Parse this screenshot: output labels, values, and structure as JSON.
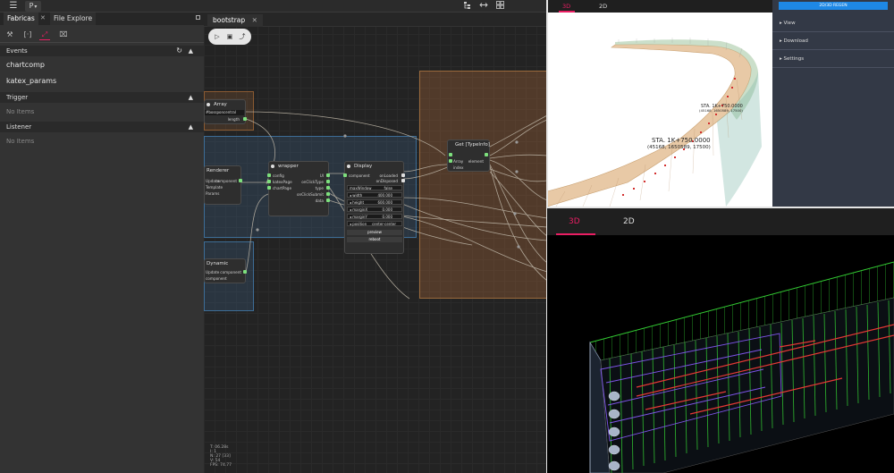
{
  "topbar": {
    "menu_icon": "menu-icon",
    "project_label": "P",
    "caret": "▾",
    "layout_icons": [
      "hierarchy-icon",
      "split-icon",
      "grid-icon"
    ]
  },
  "left_panel": {
    "tabs": [
      {
        "label": "Fabricas"
      },
      {
        "label": "File Explore"
      }
    ],
    "close_glyph": "✕",
    "tools": [
      "tools-icon",
      "braces-icon",
      "connect-icon",
      "screenshot-icon"
    ],
    "sections": {
      "events": {
        "label": "Events",
        "items": [
          "chartcomp",
          "katex_params"
        ]
      },
      "trigger": {
        "label": "Trigger",
        "empty": "No Items"
      },
      "listener": {
        "label": "Listener",
        "empty": "No Items"
      }
    }
  },
  "editor": {
    "tab_label": "bootstrap",
    "nodes": {
      "array": {
        "title": "Array",
        "field": "#bossponcentral",
        "out": "length"
      },
      "renderer": {
        "title": "Renderer",
        "inputs": [
          "Update",
          "Template",
          "Params"
        ],
        "out": "component"
      },
      "dynamic": {
        "title": "Dynamic",
        "inputs": [
          "Update",
          "component"
        ],
        "out": "component"
      },
      "wrapper": {
        "title": "wrapper",
        "inputs": [
          "config",
          "katexPage",
          "chartPage"
        ],
        "outputs": [
          "UI",
          "onClickType",
          "type",
          "onClickSubmit",
          "data"
        ]
      },
      "display": {
        "title": "Display",
        "inputs": [
          "component"
        ],
        "outputs": [
          "onLoaded",
          "onDisposed"
        ],
        "fields": [
          {
            "label": "maxWindow",
            "value": "false"
          },
          {
            "label": "width",
            "value": "400.000"
          },
          {
            "label": "height",
            "value": "600.000"
          },
          {
            "label": "marginX",
            "value": "0.000"
          },
          {
            "label": "marginY",
            "value": "0.000"
          },
          {
            "label": "position",
            "value": "center-center"
          }
        ],
        "buttons": [
          "preview",
          "reboot"
        ]
      },
      "get": {
        "title": "Get [TypeInfo]",
        "inputs": [
          "Array",
          "index"
        ],
        "outputs": [
          "element"
        ]
      }
    },
    "stats": [
      "T: 06.28s",
      "I: 1",
      "N: 27 [33]",
      "V: 54",
      "FPS: 74.77"
    ]
  },
  "viewer_top": {
    "tabs": [
      "3D",
      "2D"
    ],
    "active_tab": "3D",
    "regen_label": "2D/3D REGEN",
    "menu": [
      "View",
      "Download",
      "Settings"
    ],
    "station_label": "STA. 1K+750.0000",
    "station_coords": "(45168, 1650589, 17500)",
    "far_label_1": "STA. 1K+750.0000",
    "far_label_2": "(45168, 1650589, 17500)",
    "colors": {
      "accent": "#e91e63",
      "surface": "#e8c9a6"
    }
  },
  "viewer_bottom": {
    "tabs": [
      "3D",
      "2D"
    ],
    "active_tab": "3D"
  }
}
